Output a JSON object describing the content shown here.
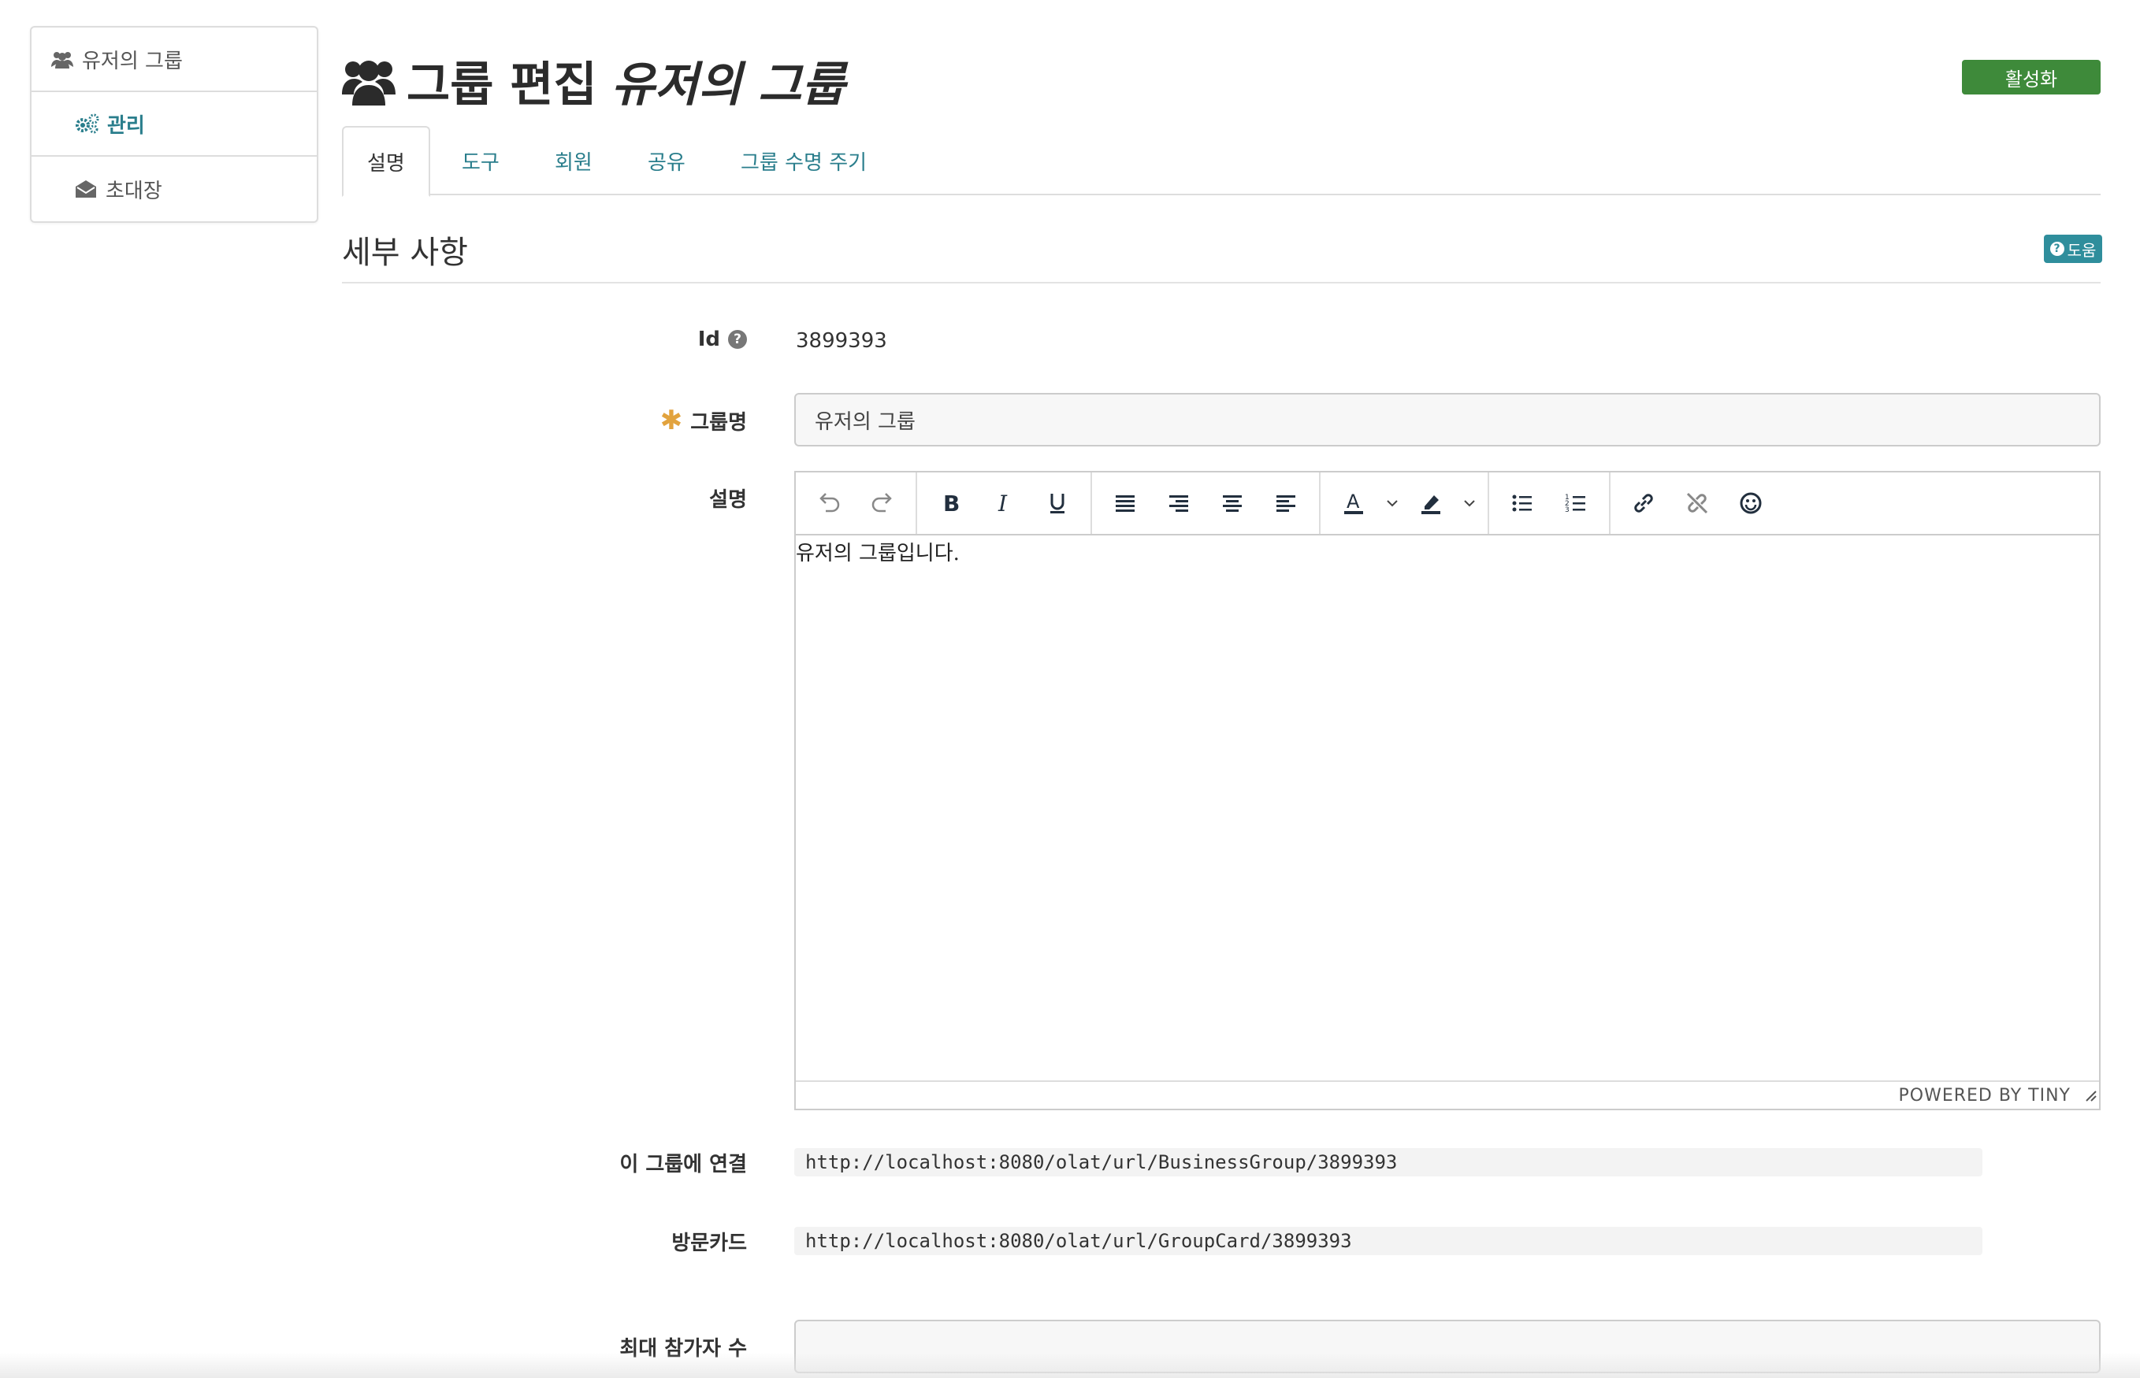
{
  "sidebar": {
    "items": [
      {
        "label": "유저의 그룹",
        "icon": "group-icon"
      },
      {
        "label": "관리",
        "icon": "cogs-icon"
      },
      {
        "label": "초대장",
        "icon": "envelope-open-icon"
      }
    ]
  },
  "header": {
    "title": "그룹 편집",
    "group_name": "유저의 그룹",
    "activate_label": "활성화"
  },
  "tabs": [
    "설명",
    "도구",
    "회원",
    "공유",
    "그룹 수명 주기"
  ],
  "section": {
    "title": "세부 사항",
    "help_label": "도움"
  },
  "form": {
    "id_label": "Id",
    "id_value": "3899393",
    "name_label": "그룹명",
    "name_value": "유저의 그룹",
    "description_label": "설명",
    "description_value": "유저의 그룹입니다.",
    "powered_by": "POWERED BY TINY",
    "link_label": "이 그룹에 연결",
    "link_value": "http://localhost:8080/olat/url/BusinessGroup/3899393",
    "card_label": "방문카드",
    "card_value": "http://localhost:8080/olat/url/GroupCard/3899393",
    "max_participants_label": "최대 참가자 수",
    "max_participants_value": ""
  },
  "colors": {
    "accent": "#2a7e8c",
    "activate": "#3e8a3a",
    "required": "#e2a33e"
  }
}
